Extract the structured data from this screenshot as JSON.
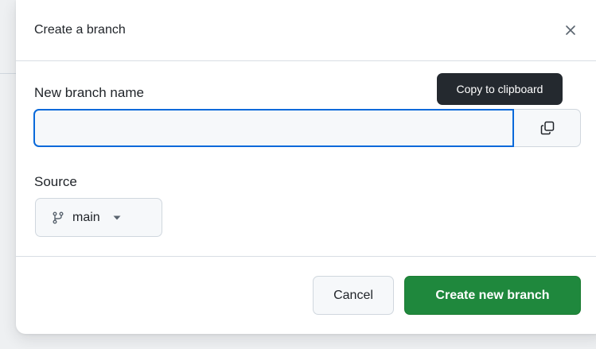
{
  "dialog": {
    "title": "Create a branch",
    "close_icon": "close-icon"
  },
  "branch_name": {
    "label": "New branch name",
    "value": "",
    "placeholder": "",
    "copy_icon": "copy-icon",
    "tooltip": "Copy to clipboard"
  },
  "source": {
    "label": "Source",
    "branch_icon": "git-branch-icon",
    "selected": "main",
    "caret_icon": "triangle-down-icon"
  },
  "actions": {
    "cancel_label": "Cancel",
    "create_label": "Create new branch"
  },
  "colors": {
    "primary": "#1f883d",
    "focus": "#0969da",
    "tooltip_bg": "#24292f"
  }
}
